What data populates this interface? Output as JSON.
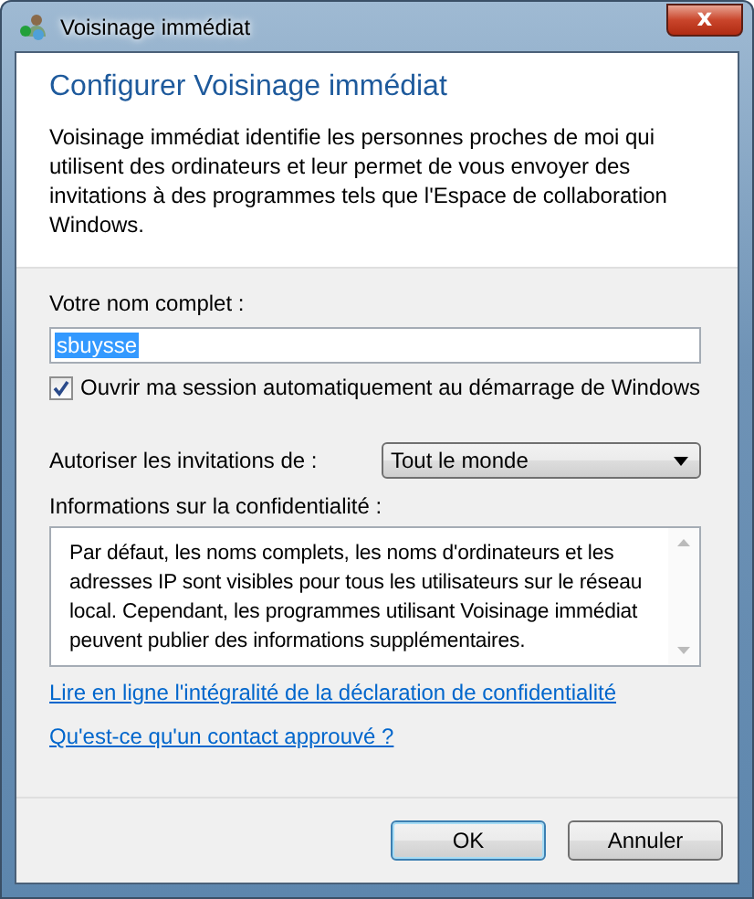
{
  "window": {
    "title": "Voisinage immédiat",
    "close_label": "x"
  },
  "heading": "Configurer Voisinage immédiat",
  "intro": "Voisinage immédiat identifie les personnes proches de moi qui utilisent des ordinateurs et leur permet de vous envoyer des invitations à des programmes tels que l'Espace de collaboration Windows.",
  "name_field": {
    "label": "Votre nom complet :",
    "value": "sbuysse"
  },
  "auto_signin": {
    "label": "Ouvrir ma session automatiquement au démarrage de Windows",
    "checked": true
  },
  "invitations": {
    "label": "Autoriser les invitations de :",
    "value": "Tout le monde"
  },
  "privacy": {
    "label": "Informations sur la confidentialité :",
    "text": "Par défaut, les noms complets, les noms d'ordinateurs et les adresses IP sont visibles pour tous les utilisateurs sur le réseau local. Cependant, les programmes utilisant Voisinage immédiat peuvent publier des informations supplémentaires."
  },
  "links": [
    "Lire en ligne l'intégralité de la déclaration de confidentialité",
    "Qu'est-ce qu'un contact approuvé ?"
  ],
  "buttons": [
    {
      "label": "OK",
      "default": true
    },
    {
      "label": "Annuler",
      "default": false
    }
  ]
}
